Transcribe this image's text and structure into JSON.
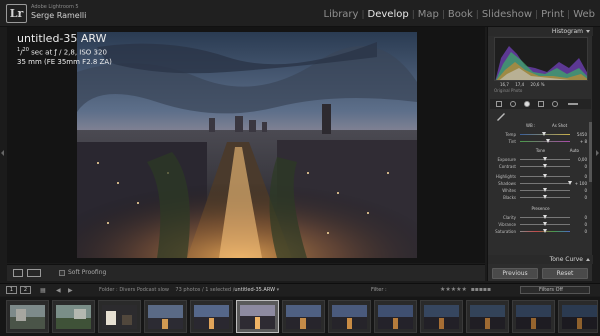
{
  "app": {
    "logo": "Lr",
    "brand": "Adobe Lightroom 5",
    "user": "Serge Ramelli"
  },
  "modules": [
    "Library",
    "Develop",
    "Map",
    "Book",
    "Slideshow",
    "Print",
    "Web"
  ],
  "active_module": "Develop",
  "photo_info": {
    "title": "untitled-35 ARW",
    "shutter_num": "1",
    "shutter_den": "20",
    "exposure_rest": " sec at ƒ / 2,8, ISO 320",
    "lens": "35 mm (FE 35mm F2.8 ZA)"
  },
  "right_panel": {
    "histogram_label": "Histogram",
    "histo_values": [
      "16,7",
      "17,4",
      "20,6 %"
    ],
    "original_photo": "Original Photo",
    "wb_label": "WB :",
    "wb_value": "As Shot",
    "sliders": [
      {
        "label": "Temp",
        "value": "5450"
      },
      {
        "label": "Tint",
        "value": "+ 8"
      },
      {
        "label": "Exposure",
        "value": "0,00"
      },
      {
        "label": "Contrast",
        "value": "0"
      },
      {
        "label": "Highlights",
        "value": "0"
      },
      {
        "label": "Shadows",
        "value": "+ 100"
      },
      {
        "label": "Whites",
        "value": "0"
      },
      {
        "label": "Blacks",
        "value": "0"
      },
      {
        "label": "Clarity",
        "value": "0"
      },
      {
        "label": "Vibrance",
        "value": "0"
      },
      {
        "label": "Saturation",
        "value": "0"
      }
    ],
    "tone_label": "Tone",
    "auto_label": "Auto",
    "presence_label": "Presence",
    "tone_curve_label": "Tone Curve",
    "previous_button": "Previous",
    "reset_button": "Reset"
  },
  "toolbar": {
    "soft_proofing": "Soft Proofing"
  },
  "filmstrip_bar": {
    "screen1": "1",
    "screen2": "2",
    "folder": "Folder : Divers Podcast slow",
    "count": "73 photos / 1 selected /",
    "selected_file": "untitled-35.ARW",
    "filter_label": "Filter :",
    "filter_dropdown": "Filters Off"
  },
  "filmstrip": {
    "count": 13,
    "selected_index": 5
  }
}
